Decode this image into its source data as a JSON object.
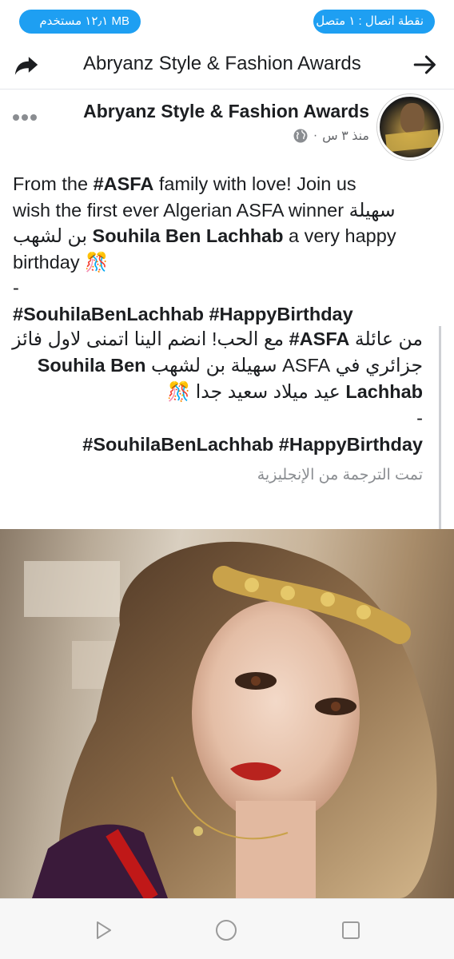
{
  "status_bar": {
    "data_usage": "MB ١٢٫١ مستخدم",
    "hotspot": "نقطة اتصال : ١ متصل"
  },
  "app_bar": {
    "title": "Abryanz Style & Fashion Awards",
    "share_icon": "share-icon",
    "back_icon": "arrow-right-icon"
  },
  "post": {
    "page_name": "Abryanz Style & Fashion Awards",
    "time": "منذ ٣ س",
    "separator": "·",
    "privacy_icon": "globe-icon",
    "text": {
      "l1_pre": "From the ",
      "l1_bold": "#ASFA",
      "l1_post": " family with love! Join us",
      "l2_text": "wish the first ever Algerian ASFA winner ",
      "l2_ar": "سهيلة",
      "l3_ar": "بن لشهب",
      "l3_bold": "Souhila Ben Lachhab",
      "l3_post": " a very happy",
      "l4_text": "birthday",
      "l4_emoji": "🎊",
      "l5": "-",
      "l6": "#SouhilaBenLachhab  #HappyBirthday"
    },
    "translation": {
      "t1_pre": "من عائلة ",
      "t1_bold": "ASFA#",
      "t1_post": " مع الحب! انضم الينا اتمنى لاول فائز",
      "t2_pre": "جزائري في ASFA سهيلة بن لشهب ",
      "t2_bold": "Souhila Ben",
      "t3_bold": "Lachhab",
      "t3_post": " عيد ميلاد سعيد جدا",
      "t3_emoji": "🎊",
      "t4": "-",
      "t5": "#SouhilaBenLachhab  #HappyBirthday",
      "note": "تمت الترجمة من الإنجليزية"
    },
    "photo_alt": "photo"
  },
  "nav_bar": {
    "back_icon": "triangle-back-icon",
    "home_icon": "circle-home-icon",
    "recents_icon": "square-recents-icon"
  },
  "colors": {
    "pill": "#1e9ff2",
    "text": "#1c1e21",
    "muted": "#65676b"
  }
}
